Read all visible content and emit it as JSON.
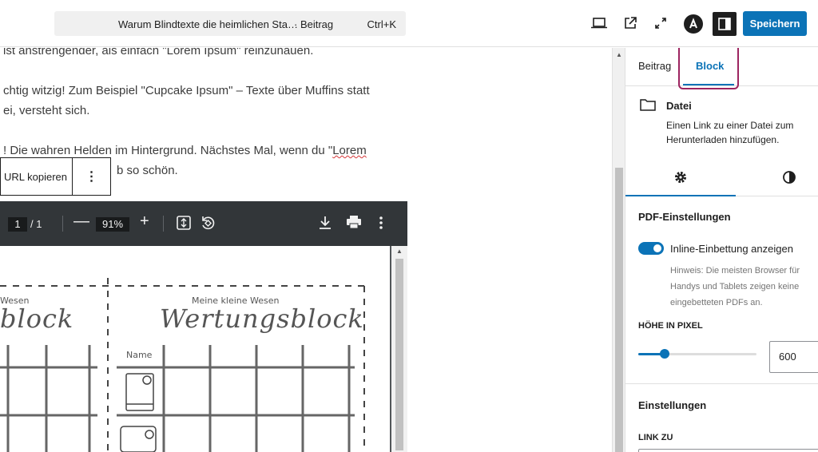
{
  "header": {
    "doc_title": "Warum Blindtexte die heimlichen Sta…",
    "doc_type": "· Beitrag",
    "shortcut": "Ctrl+K",
    "save_label": "Speichern",
    "icons": [
      "desktop-view-icon",
      "external-link-icon",
      "fullscreen-icon",
      "site-logo-icon",
      "settings-sidebar-icon"
    ]
  },
  "editor": {
    "paragraph_1": "ist anstrengender, als einfach \"Lorem Ipsum\" reinzuhauen.",
    "paragraph_2_line_1": "chtig witzig! Zum Beispiel \"Cupcake Ipsum\" – Texte über Muffins statt",
    "paragraph_2_line_2": "ei, versteht sich.",
    "paragraph_3_line_1_a": "! Die wahren Helden im Hintergrund. Nächstes Mal, wenn du \"",
    "paragraph_3_line_1_b": "Lorem",
    "paragraph_3_line_2": "b so schön.",
    "block_toolbar": {
      "copy_url": "URL kopieren",
      "more": "⋮"
    }
  },
  "pdf_viewer": {
    "current_page": "1",
    "total_pages": "/ 1",
    "zoom": "91%",
    "zoom_minus": "—",
    "zoom_plus": "+",
    "page_content": {
      "left_subtitle": "Wesen",
      "left_title": "block",
      "right_subtitle": "Meine kleine Wesen",
      "right_title": "Wertungsblock",
      "name_label": "Name"
    }
  },
  "sidebar": {
    "tabs": [
      {
        "label": "Beitrag",
        "active": false
      },
      {
        "label": "Block",
        "active": true
      }
    ],
    "block": {
      "name": "Datei",
      "description": "Einen Link zu einer Datei zum Herunterladen hinzufügen."
    },
    "sub_tabs": [
      "settings-gear-icon",
      "styles-contrast-icon"
    ],
    "pdf_settings": {
      "title": "PDF-Einstellungen",
      "toggle_label": "Inline-Einbettung anzeigen",
      "toggle_on": true,
      "help": "Hinweis: Die meisten Browser für Handys und Tablets zeigen keine eingebetteten PDFs an.",
      "height_label": "Höhe in Pixel",
      "height_value": "600",
      "height_range": {
        "min": 200,
        "max": 2000,
        "value": 600
      }
    },
    "settings": {
      "title": "Einstellungen",
      "link_label": "Link zu"
    }
  },
  "colors": {
    "accent": "#0b73b7",
    "highlight": "#9d2460",
    "dark": "#1e1e1e"
  }
}
